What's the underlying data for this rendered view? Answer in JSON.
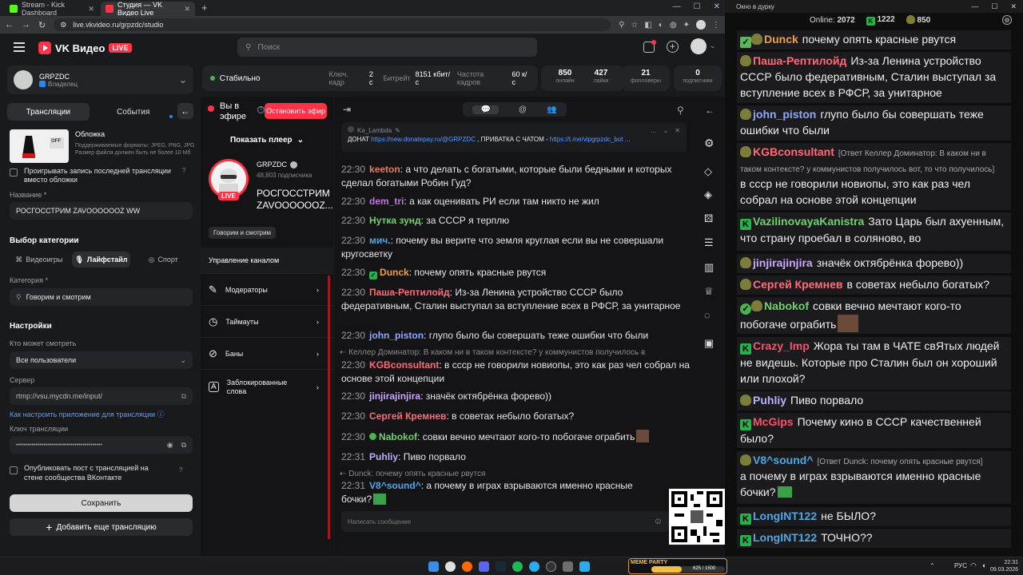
{
  "browser": {
    "tabs": [
      {
        "title": "Stream - Kick Dashboard",
        "color": "#53fc18"
      },
      {
        "title": "Студия — VK Видео Live",
        "color": "#ff3347"
      }
    ],
    "url": "live.vkvideo.ru/grpzdc/studio"
  },
  "header": {
    "brand": "VK Видео",
    "live_badge": "LIVE",
    "search_placeholder": "Поиск"
  },
  "owner": {
    "name": "GRPZDC",
    "role": "Владелец"
  },
  "left": {
    "tabs": [
      "Трансляции",
      "События"
    ],
    "cover": {
      "title": "Обложка",
      "hint": "Поддерживаемые форматы: JPEG, PNG, JPG Размер файла должен быть не более 10 Мб",
      "thumb_text": "OFF"
    },
    "play_last_label": "Проигрывать запись последней трансляции вместо обложки",
    "name_label": "Название *",
    "name_value": "РОСГОССТРИМ ZAVOOOOOOZ WW",
    "category_heading": "Выбор категории",
    "category_tabs": [
      "Видеоигры",
      "Лайфстайл",
      "Спорт"
    ],
    "category_label": "Категория *",
    "category_value": "Говорим и смотрим",
    "settings_heading": "Настройки",
    "who_label": "Кто может смотреть",
    "who_value": "Все пользователи",
    "server_label": "Сервер",
    "server_value": "rtmp://vsu.mycdn.me/input/",
    "setup_link": "Как настроить приложение для трансляции",
    "key_label": "Ключ трансляции",
    "key_value": "••••••••••••••••••••••••••••••••••••••••••••",
    "publish_label": "Опубликовать пост с трансляцией на стене сообщества ВКонтакте",
    "save_button": "Сохранить",
    "add_button": "Добавить еще трансляцию"
  },
  "stats": {
    "status": "Стабильно",
    "keyframe_label": "Ключ. кадр",
    "keyframe_value": "2 с",
    "bitrate_label": "Битрейт",
    "bitrate_value": "8151 кбит/с",
    "fps_label": "Частота кадров",
    "fps_value": "60 к/с",
    "boxes": [
      {
        "value": "850",
        "label": "онлайн"
      },
      {
        "value": "427",
        "label": "лайки"
      },
      {
        "value": "21",
        "label": "фолловеры"
      },
      {
        "value": "0",
        "label": "подписчики"
      }
    ]
  },
  "stream": {
    "on_air": "Вы в эфире",
    "stop_button": "Остановить эфир",
    "show_player": "Показать плеер",
    "channel_name": "GRPZDC",
    "subscribers": "48,803 подписчика",
    "title": "РОСГОССТРИМ ZAVOOOOOOZ...",
    "category_tag": "Говорим и смотрим",
    "manage_heading": "Управление каналом",
    "menu": [
      "Модераторы",
      "Таймауты",
      "Баны",
      "Заблокированные слова"
    ],
    "live_label": "LIVE"
  },
  "chat": {
    "pinned_author": "Ka_Lambda",
    "pinned_prefix": "ДОНАТ ",
    "pinned_link1": "https://new.donatepay.ru/@GRPZDC",
    "pinned_mid": " , ПРИВАТКА С ЧАТОМ - ",
    "pinned_link2": "https://t.me/vipgrpzdc_bot ...",
    "messages": [
      {
        "time": "22:30",
        "user": "keeton",
        "color": "#e67e5a",
        "text": "а что делать с богатыми, которые были бедными и которых сделал богатыми Робин Гуд?"
      },
      {
        "time": "22:30",
        "user": "dem_tri",
        "color": "#c86ee6",
        "text": "а как оценивать РИ если там никто не жил"
      },
      {
        "time": "22:30",
        "user": "Нутка зунд",
        "color": "#6ed26e",
        "text": "за СССР я терплю"
      },
      {
        "time": "22:30",
        "user": "мич.",
        "color": "#4ea8e6",
        "text": "почему вы верите что земля круглая если вы не совершали кругосветку"
      },
      {
        "time": "22:30",
        "user": "Dunck",
        "color": "#f0a040",
        "text": "почему опять красные рвутся"
      },
      {
        "time": "22:30",
        "user": "Паша-Рептилойд",
        "color": "#ff6b7a",
        "text": "Из-за Ленина устройство СССР было федеративным, Сталин выступал за вступление всех в РФСР, за унитарное"
      },
      {
        "time": "22:30",
        "user": "john_piston",
        "color": "#8fa8ff",
        "text": "глупо было бы совершать теже ошибки что были"
      },
      {
        "time": "22:30",
        "user": "KGBconsultant",
        "color": "#ff6b7a",
        "text": "в ссср не говорили новиопы, это как раз чел собрал на основе этой концепции"
      },
      {
        "time": "22:30",
        "user": "jinjirajinjira",
        "color": "#c9a8ff",
        "text": "значёк октябрёнка форево))"
      },
      {
        "time": "22:30",
        "user": "Сергей Кремнев",
        "color": "#ff6b7a",
        "text": "в советах небыло богатых?"
      },
      {
        "time": "22:30",
        "user": "Nabokof",
        "color": "#6ed26e",
        "text": "совки вечно мечтают кого-то побогаче ограбить"
      },
      {
        "time": "22:31",
        "user": "Puhliy",
        "color": "#b8b0ff",
        "text": "Пиво порвало"
      },
      {
        "time": "22:31",
        "user": "V8^sound^",
        "color": "#4ea8e6",
        "text": "а почему в играх взрываются именно красные бочки?"
      }
    ],
    "reply1": "Келлер Доминатор: В каком ни в таком контексте? у коммунистов получилось в",
    "reply2": "Dunck: почему опять красные рвутся",
    "input_placeholder": "Написать сообщение"
  },
  "overlay": {
    "window_title": "Окно в дурку",
    "online_label": "Online:",
    "online_value": "2072",
    "kick_count": "1222",
    "vk_count": "850",
    "messages": [
      {
        "user": "Dunck",
        "color": "#f0a040",
        "badge": "s",
        "text": "почему опять красные рвутся"
      },
      {
        "user": "Паша-Рептилойд",
        "color": "#ff6b7a",
        "badge": "s",
        "text": "Из-за Ленина устройство СССР было федеративным, Сталин выступал за вступление всех в РФСР, за унитарное"
      },
      {
        "user": "john_piston",
        "color": "#8fa8ff",
        "badge": "s",
        "text": "глупо было бы совершать теже ошибки что были"
      },
      {
        "user": "KGBconsultant",
        "color": "#ff6b7a",
        "badge": "s",
        "reply": "[Ответ Келлер Доминатор: В каком ни в таком контексте? у коммунистов получилось вот, то что получилось]",
        "text": "в ссср не говорили новиопы, это как раз чел собрал на основе этой концепции"
      },
      {
        "user": "VazilinovayaKanistra",
        "color": "#6ed26e",
        "badge": "k",
        "text": "Зато Царь был ахуенным, что страну проебал в соляново, во"
      },
      {
        "user": "jinjirajinjira",
        "color": "#c9a8ff",
        "badge": "s",
        "text": "значёк октябрёнка форево))"
      },
      {
        "user": "Сергей Кремнев",
        "color": "#ff6b7a",
        "badge": "s",
        "text": "в советах небыло богатых?"
      },
      {
        "user": "Nabokof",
        "color": "#6ed26e",
        "badge": "s",
        "text": "совки вечно мечтают кого-то побогаче ограбить"
      },
      {
        "user": "Crazy_Imp",
        "color": "#ff4f6a",
        "badge": "k",
        "text": "Жора ты там в ЧАТЕ свЯтых людей не видешь. Которые про Сталин был он хороший или плохой?"
      },
      {
        "user": "Puhliy",
        "color": "#b8b0ff",
        "badge": "s",
        "text": "Пиво порвало"
      },
      {
        "user": "McGips",
        "color": "#ff4f6a",
        "badge": "k",
        "text": "Почему кино в СССР качественней было?"
      },
      {
        "user": "V8^sound^",
        "color": "#4ea8e6",
        "badge": "s",
        "reply": "[Ответ Dunck: почему опять красные рвутся]",
        "text": "а почему в играх взрываются именно красные бочки?"
      },
      {
        "user": "LongINT122",
        "color": "#4ea8e6",
        "badge": "k",
        "text": "не БЫЛО?"
      },
      {
        "user": "LongINT122",
        "color": "#4ea8e6",
        "badge": "k",
        "text": "ТОЧНО??"
      }
    ]
  },
  "taskbar": {
    "lang": "РУС",
    "time": "22:31",
    "date": "09.03.2026",
    "widget_label": "MEME PARTY",
    "widget_progress": "625 / 1500"
  },
  "colors": {
    "accent": "#ff3347",
    "vk_blue": "#2787f5",
    "kick_green": "#53fc18",
    "ok_green": "#4bb34b"
  }
}
